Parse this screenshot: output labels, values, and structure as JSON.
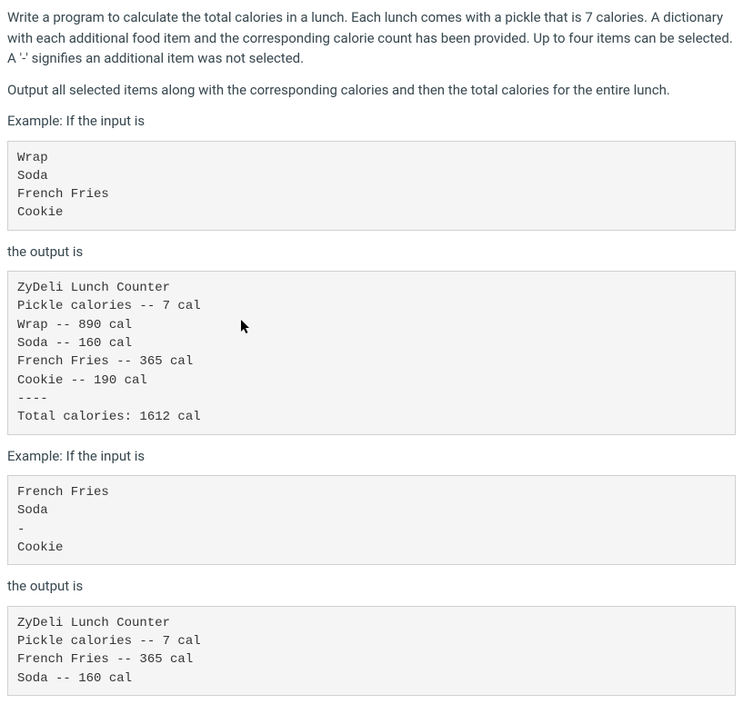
{
  "intro_paragraph": "Write a program to calculate the total calories in a lunch. Each lunch comes with a pickle that is 7 calories. A dictionary with each additional food item and the corresponding calorie count has been provided. Up to four items can be selected. A '-' signifies an additional item was not selected.",
  "output_instruction": "Output all selected items along with the corresponding calories and then the total calories for the entire lunch.",
  "example1_label": "Example: If the input is",
  "example1_input": "Wrap\nSoda\nFrench Fries\nCookie",
  "example1_output_label": "the output is",
  "example1_output": "ZyDeli Lunch Counter\nPickle calories -- 7 cal\nWrap -- 890 cal\nSoda -- 160 cal\nFrench Fries -- 365 cal\nCookie -- 190 cal\n----\nTotal calories: 1612 cal",
  "example2_label": "Example: If the input is",
  "example2_input": "French Fries\nSoda\n-\nCookie",
  "example2_output_label": "the output is",
  "example2_output": "ZyDeli Lunch Counter\nPickle calories -- 7 cal\nFrench Fries -- 365 cal\nSoda -- 160 cal"
}
